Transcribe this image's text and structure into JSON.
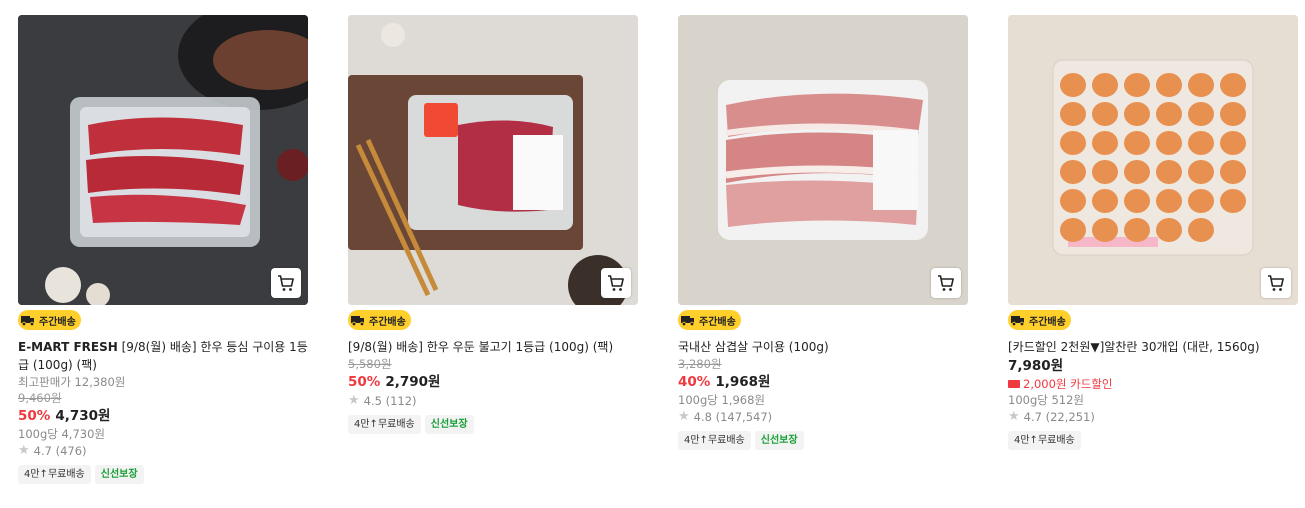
{
  "products": [
    {
      "badge": "주간배송",
      "brand": "E-MART FRESH",
      "title": " [9/8(월) 배송] 한우 등심 구이용 1등급 (100g) (팩)",
      "max_price_label": "최고판매가 12,380원",
      "original_price": "9,460원",
      "discount": "50%",
      "price": "4,730원",
      "unit_price": "100g당 4,730원",
      "rating": "4.7",
      "reviews": "(476)",
      "tags": [
        "4만↑무료배송",
        "신선보장"
      ]
    },
    {
      "badge": "주간배송",
      "title": "[9/8(월) 배송] 한우 우둔 불고기 1등급 (100g) (팩)",
      "original_price": "5,580원",
      "discount": "50%",
      "price": "2,790원",
      "rating": "4.5",
      "reviews": "(112)",
      "tags": [
        "4만↑무료배송",
        "신선보장"
      ]
    },
    {
      "badge": "주간배송",
      "title": "국내산 삼겹살 구이용 (100g)",
      "original_price": "3,280원",
      "discount": "40%",
      "price": "1,968원",
      "unit_price": "100g당 1,968원",
      "rating": "4.8",
      "reviews": "(147,547)",
      "tags": [
        "4만↑무료배송",
        "신선보장"
      ]
    },
    {
      "badge": "주간배송",
      "title": "[카드할인 2천원▼]알찬란 30개입 (대란, 1560g)",
      "price": "7,980원",
      "card_discount": "2,000원 카드할인",
      "unit_price": "100g당 512원",
      "rating": "4.7",
      "reviews": "(22,251)",
      "tags": [
        "4만↑무료배송"
      ]
    }
  ],
  "colors": {
    "accent_red": "#f0393f",
    "badge_yellow": "#ffd02b",
    "fresh_green": "#189f38"
  },
  "icons": {
    "cart": "cart-icon",
    "truck": "truck-icon",
    "star": "star-icon"
  }
}
